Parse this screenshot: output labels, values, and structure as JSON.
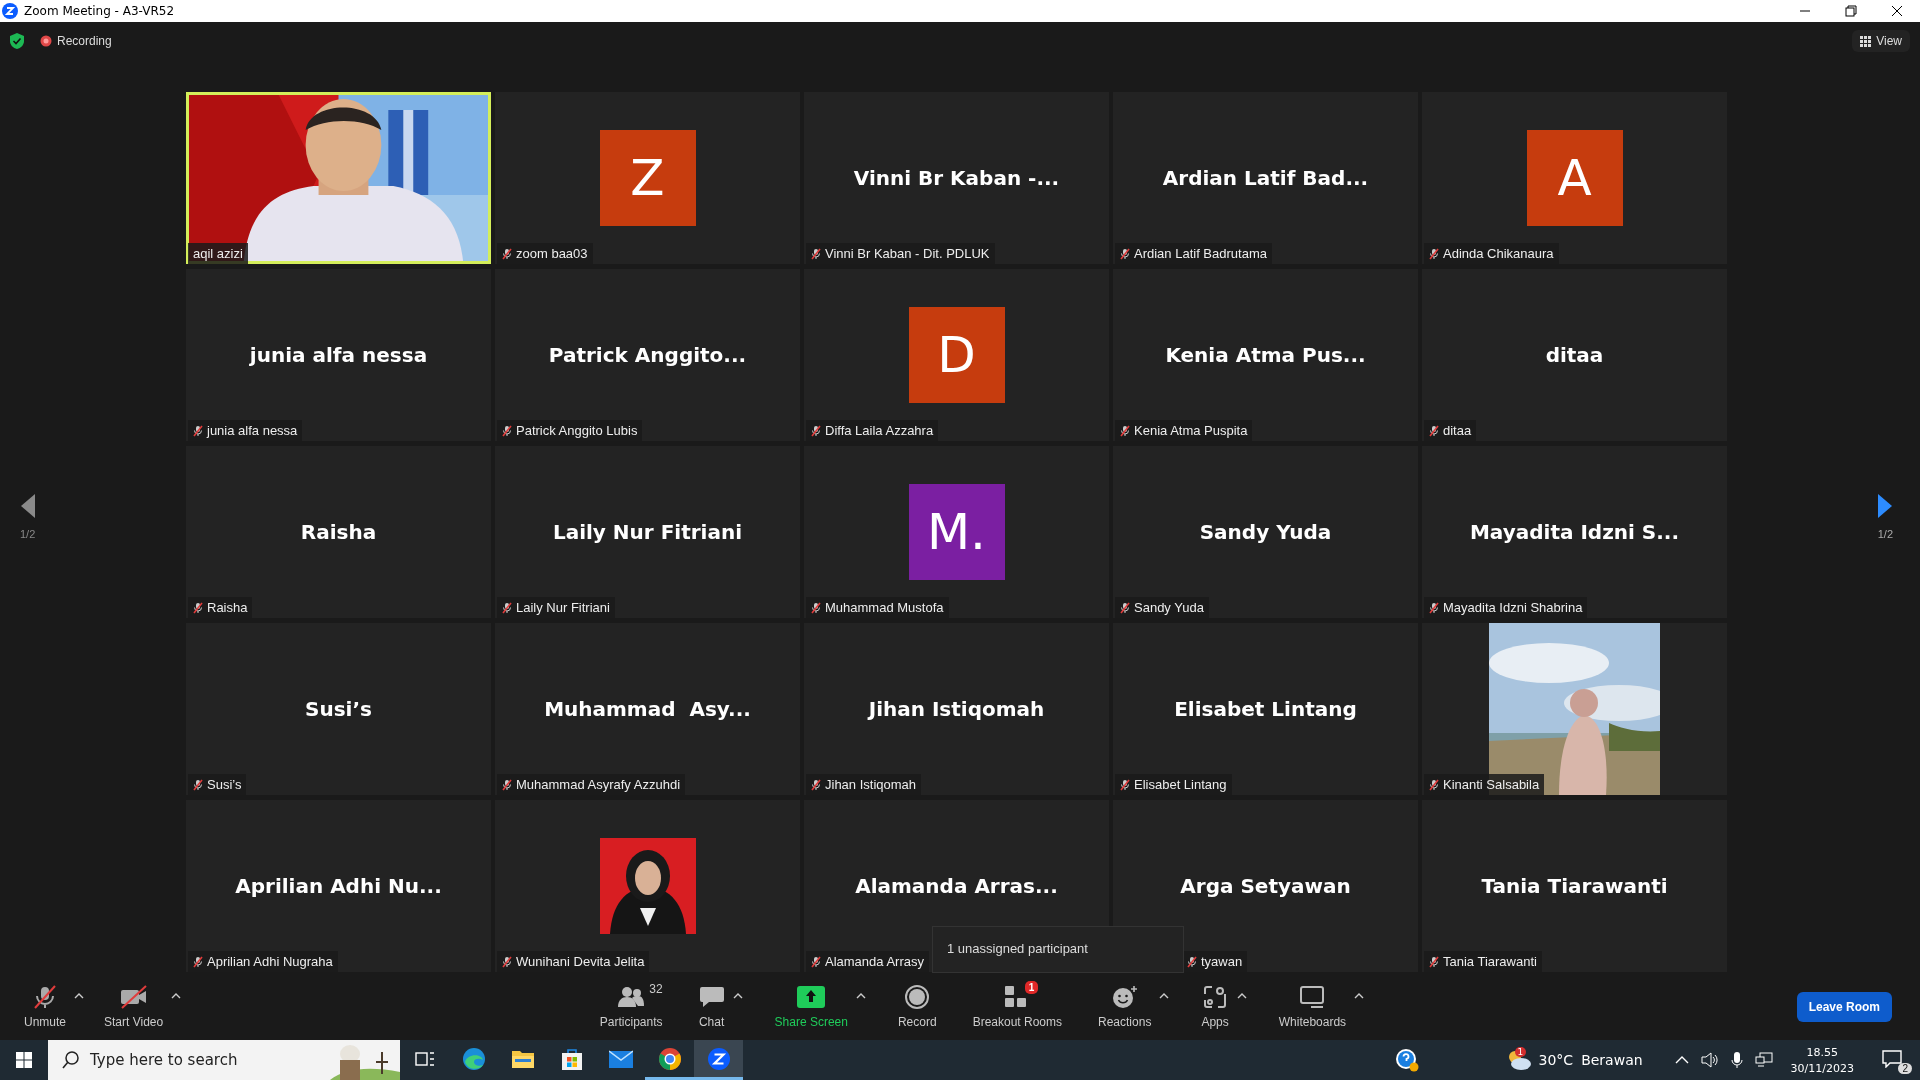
{
  "window": {
    "title": "Zoom Meeting - A3-VR52"
  },
  "top_bar": {
    "recording": "Recording",
    "view": "View"
  },
  "pager": [
    {
      "label": "1/2",
      "disabled": true
    },
    {
      "label": "1/2",
      "disabled": false
    }
  ],
  "tiles": [
    {
      "kind": "video",
      "label": "aqil azizi",
      "muted": false,
      "speaking": true,
      "covered": false
    },
    {
      "kind": "avatar",
      "display": "Z",
      "color": "#c63c0e",
      "label": "zoom baa03",
      "muted": true,
      "speaking": false,
      "covered": false
    },
    {
      "kind": "name",
      "display": "Vinni Br Kaban -...",
      "label": "Vinni Br Kaban - Dit. PDLUK",
      "muted": true,
      "speaking": false,
      "covered": false
    },
    {
      "kind": "name",
      "display": "Ardian Latif Bad...",
      "label": "Ardian Latif Badrutama",
      "muted": true,
      "speaking": false,
      "covered": false
    },
    {
      "kind": "avatar",
      "display": "A",
      "color": "#c63c0e",
      "label": "Adinda Chikanaura",
      "muted": true,
      "speaking": false,
      "covered": false
    },
    {
      "kind": "name",
      "display": "junia alfa nessa",
      "label": "junia alfa nessa",
      "muted": true,
      "speaking": false,
      "covered": false
    },
    {
      "kind": "name",
      "display": "Patrick Anggito...",
      "label": "Patrick Anggito Lubis",
      "muted": true,
      "speaking": false,
      "covered": false
    },
    {
      "kind": "avatar",
      "display": "D",
      "color": "#c63c0e",
      "label": "Diffa Laila Azzahra",
      "muted": true,
      "speaking": false,
      "covered": false
    },
    {
      "kind": "name",
      "display": "Kenia Atma Pus...",
      "label": "Kenia Atma Puspita",
      "muted": true,
      "speaking": false,
      "covered": false
    },
    {
      "kind": "name",
      "display": "ditaa",
      "label": "ditaa",
      "muted": true,
      "speaking": false,
      "covered": false
    },
    {
      "kind": "name",
      "display": "Raisha",
      "label": "Raisha",
      "muted": true,
      "speaking": false,
      "covered": false
    },
    {
      "kind": "name",
      "display": "Laily Nur Fitriani",
      "label": "Laily Nur Fitriani",
      "muted": true,
      "speaking": false,
      "covered": false
    },
    {
      "kind": "avatar",
      "display": "M.",
      "color": "#7b1fa2",
      "label": "Muhammad Mustofa",
      "muted": true,
      "speaking": false,
      "covered": false
    },
    {
      "kind": "name",
      "display": "Sandy Yuda",
      "label": "Sandy Yuda",
      "muted": true,
      "speaking": false,
      "covered": false
    },
    {
      "kind": "name",
      "display": "Mayadita Idzni S...",
      "label": "Mayadita Idzni Shabrina",
      "muted": true,
      "speaking": false,
      "covered": false
    },
    {
      "kind": "name",
      "display": "Susi’s",
      "label": "Susi’s",
      "muted": true,
      "speaking": false,
      "covered": false
    },
    {
      "kind": "name",
      "display": "Muhammad  Asy...",
      "label": "Muhammad Asyrafy Azzuhdi",
      "muted": true,
      "speaking": false,
      "covered": false
    },
    {
      "kind": "name",
      "display": "Jihan Istiqomah",
      "label": "Jihan Istiqomah",
      "muted": true,
      "speaking": false,
      "covered": false
    },
    {
      "kind": "name",
      "display": "Elisabet Lintang",
      "label": "Elisabet Lintang",
      "muted": true,
      "speaking": false,
      "covered": false
    },
    {
      "label": "Kinanti Salsabila",
      "muted": true,
      "speaking": false,
      "covered": false
    },
    {
      "kind": "name",
      "display": "Aprilian Adhi Nu...",
      "label": "Aprilian Adhi Nugraha",
      "muted": true,
      "speaking": false,
      "covered": false
    },
    {
      "kind": "portrait",
      "label": "Wunihani Devita Jelita",
      "muted": true,
      "speaking": false,
      "covered": false
    },
    {
      "kind": "name",
      "display": "Alamanda Arras...",
      "label": "Alamanda Arrasy",
      "muted": true,
      "speaking": false,
      "covered": false
    },
    {
      "kind": "name",
      "display": "Arga Setyawan",
      "label": "tyawan",
      "muted": true,
      "speaking": false,
      "covered": true
    },
    {
      "kind": "name",
      "display": "Tania Tiarawanti",
      "label": "Tania Tiarawanti",
      "muted": true,
      "speaking": false,
      "covered": false
    }
  ],
  "breakout_tooltip": "1 unassigned participant",
  "toolbar": {
    "left": [
      {
        "label": "Unmute",
        "caret": true
      },
      {
        "label": "Start Video",
        "caret": true
      }
    ],
    "center": [
      {
        "label": "Participants",
        "count": "32",
        "caret": false,
        "kind": "plain"
      },
      {
        "label": "Chat",
        "caret": true,
        "kind": "plain"
      },
      {
        "label": "Share Screen",
        "caret": true,
        "kind": "share"
      },
      {
        "label": "Record",
        "caret": false,
        "kind": "plain"
      },
      {
        "label": "Breakout Rooms",
        "badge": "1",
        "caret": false,
        "kind": "plain"
      },
      {
        "label": "Reactions",
        "caret": true,
        "kind": "plain"
      },
      {
        "label": "Apps",
        "caret": true,
        "kind": "plain"
      },
      {
        "label": "Whiteboards",
        "caret": true,
        "kind": "plain"
      }
    ],
    "leave": "Leave Room"
  },
  "taskbar": {
    "search_placeholder": "Type here to search",
    "apps": [
      {
        "running": false,
        "selected": false
      },
      {
        "running": false,
        "selected": false
      },
      {
        "running": false,
        "selected": false
      },
      {
        "running": false,
        "selected": false
      },
      {
        "running": false,
        "selected": false
      },
      {
        "running": true,
        "selected": false
      },
      {
        "running": true,
        "selected": true
      }
    ],
    "weather_badge": "1",
    "temperature": "30°C",
    "weather": "Berawan",
    "time": "18.55",
    "date": "30/11/2023",
    "notifications": "2"
  }
}
